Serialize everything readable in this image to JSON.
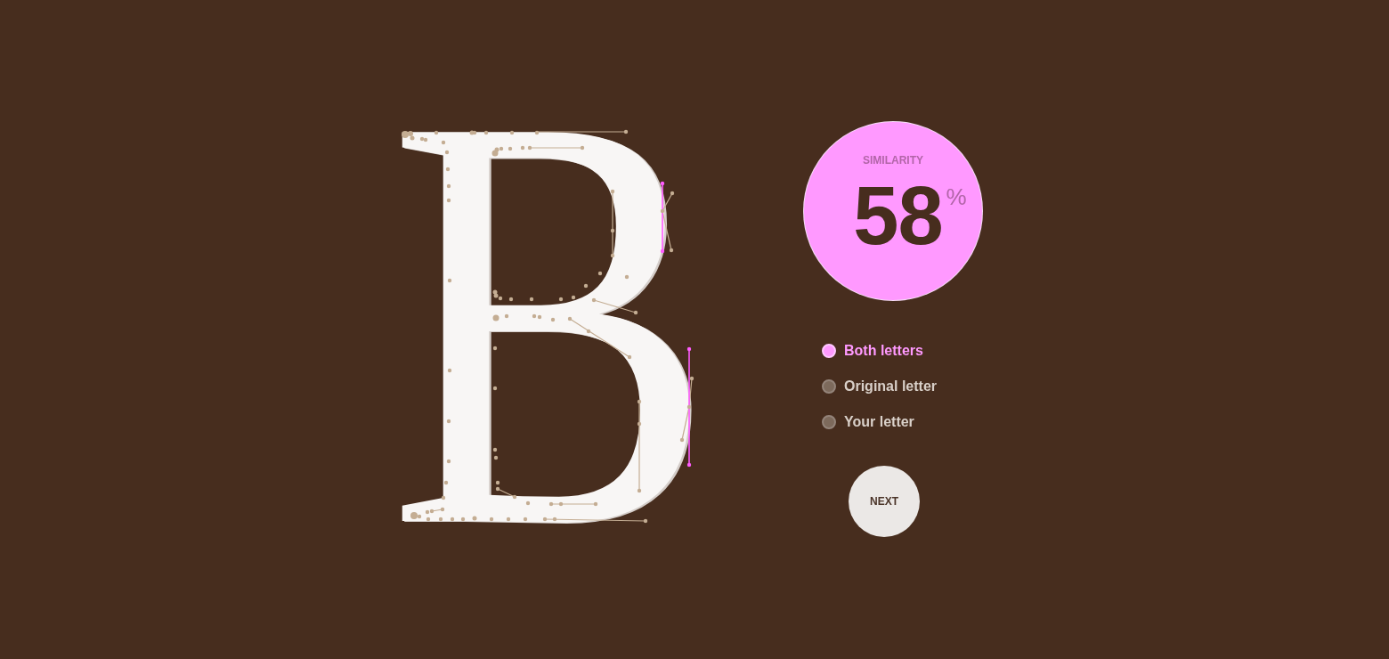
{
  "canvas": {
    "letter": "B"
  },
  "similarity": {
    "label": "SIMILARITY",
    "value": "58",
    "unit": "%"
  },
  "view_options": [
    {
      "label": "Both letters",
      "selected": true
    },
    {
      "label": "Original letter",
      "selected": false
    },
    {
      "label": "Your letter",
      "selected": false
    }
  ],
  "next_button": {
    "label": "NEXT"
  }
}
